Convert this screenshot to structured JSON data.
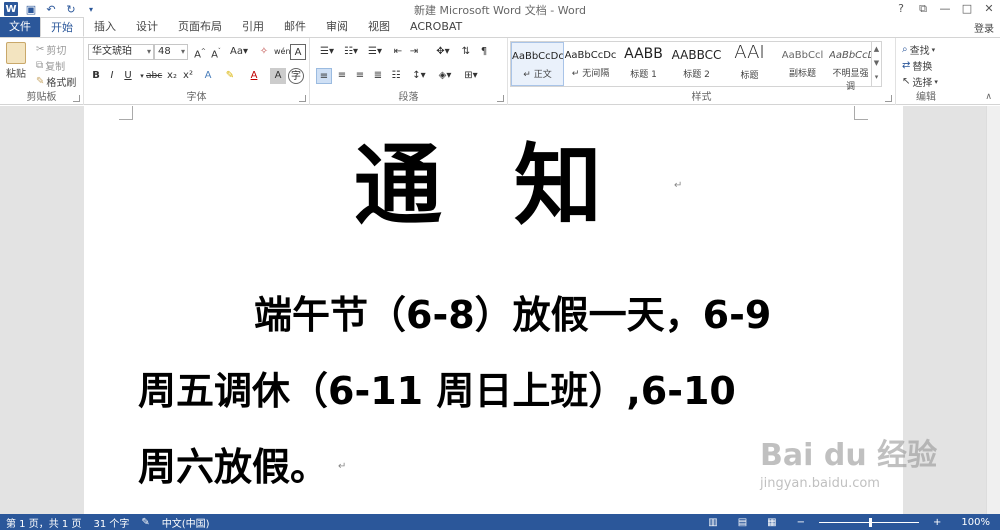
{
  "window": {
    "title": "新建 Microsoft Word 文档 - Word",
    "help": "?",
    "restore": "⧉",
    "minimize": "—",
    "maximize": "□",
    "close": "✕",
    "login": "登录"
  },
  "tabs": [
    {
      "label": "文件"
    },
    {
      "label": "开始"
    },
    {
      "label": "插入"
    },
    {
      "label": "设计"
    },
    {
      "label": "页面布局"
    },
    {
      "label": "引用"
    },
    {
      "label": "邮件"
    },
    {
      "label": "审阅"
    },
    {
      "label": "视图"
    },
    {
      "label": "ACROBAT"
    }
  ],
  "ribbon": {
    "clipboard": {
      "label": "剪贴板",
      "paste": "粘贴",
      "cut": "剪切",
      "copy": "复制",
      "format_painter": "格式刷"
    },
    "font": {
      "label": "字体",
      "font_name": "华文琥珀",
      "font_size": "48"
    },
    "paragraph": {
      "label": "段落"
    },
    "styles": {
      "label": "样式",
      "items": [
        {
          "sample": "AaBbCcDc",
          "name": "↵ 正文"
        },
        {
          "sample": "AaBbCcDc",
          "name": "↵ 无间隔"
        },
        {
          "sample": "AABB",
          "name": "标题 1"
        },
        {
          "sample": "AABBCC",
          "name": "标题 2"
        },
        {
          "sample": "AAI",
          "name": "标题"
        },
        {
          "sample": "AaBbCcl",
          "name": "副标题"
        },
        {
          "sample": "AaBbCcDc",
          "name": "不明显强调"
        }
      ]
    },
    "editing": {
      "label": "编辑",
      "find": "查找",
      "replace": "替换",
      "select": "选择"
    }
  },
  "document": {
    "title": "通知",
    "line1": "端午节（6-8）放假一天，6-9",
    "line2": "周五调休（6-11 周日上班）,6-10",
    "line3": "周六放假。",
    "para_mark": "↵"
  },
  "watermark": {
    "logo": "Bai du 经验",
    "url": "jingyan.baidu.com"
  },
  "status": {
    "page": "第 1 页，共 1 页",
    "words": "31 个字",
    "language": "中文(中国)",
    "zoom": "100%",
    "zoom_minus": "−",
    "zoom_plus": "+"
  }
}
